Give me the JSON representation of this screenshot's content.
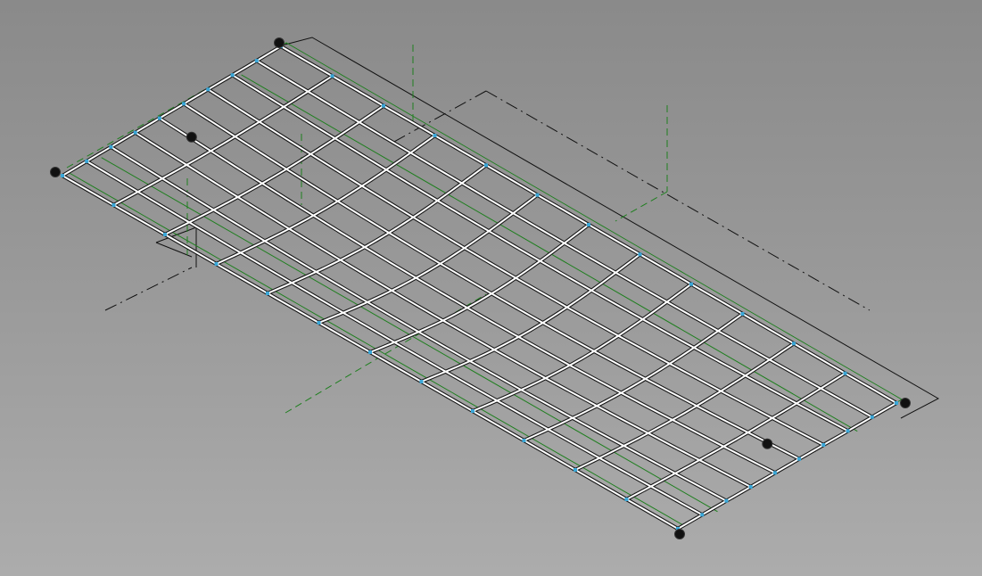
{
  "viewport": {
    "view": "3d-wireframe",
    "colors": {
      "background_top": "#8a8a8a",
      "background_bottom": "#acacac",
      "grid_line_light": "#ffffff",
      "grid_line_dark": "#1a1a1a",
      "boundary_green": "#1f7f1f",
      "reference_dark": "#111111",
      "node_blue": "#3aa7d8",
      "control_point": "#111111"
    },
    "icons": {
      "control_point": "control-point-icon",
      "node": "node-marker-icon"
    }
  },
  "surface": {
    "divisions_long": 12,
    "divisions_short": 9,
    "control_points": 6
  }
}
